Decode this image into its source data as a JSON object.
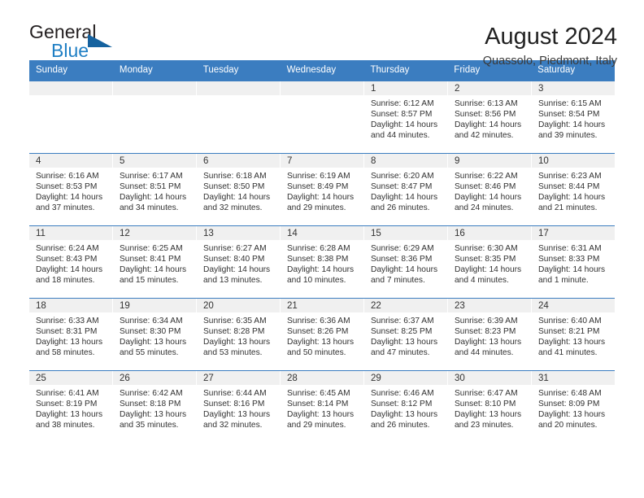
{
  "brand": {
    "name_part1": "General",
    "name_part2": "Blue",
    "triangle_icon": "triangle-icon",
    "accent_color": "#1f7fc4",
    "header_color": "#3b7dc0"
  },
  "header": {
    "title": "August 2024",
    "subtitle": "Quassolo, Piedmont, Italy"
  },
  "calendar": {
    "weekday_headers": [
      "Sunday",
      "Monday",
      "Tuesday",
      "Wednesday",
      "Thursday",
      "Friday",
      "Saturday"
    ],
    "labels": {
      "sunrise": "Sunrise:",
      "sunset": "Sunset:",
      "daylight": "Daylight:"
    },
    "weeks": [
      [
        {
          "day": "",
          "empty": true
        },
        {
          "day": "",
          "empty": true
        },
        {
          "day": "",
          "empty": true
        },
        {
          "day": "",
          "empty": true
        },
        {
          "day": "1",
          "sunrise": "Sunrise: 6:12 AM",
          "sunset": "Sunset: 8:57 PM",
          "daylight_l1": "Daylight: 14 hours",
          "daylight_l2": "and 44 minutes."
        },
        {
          "day": "2",
          "sunrise": "Sunrise: 6:13 AM",
          "sunset": "Sunset: 8:56 PM",
          "daylight_l1": "Daylight: 14 hours",
          "daylight_l2": "and 42 minutes."
        },
        {
          "day": "3",
          "sunrise": "Sunrise: 6:15 AM",
          "sunset": "Sunset: 8:54 PM",
          "daylight_l1": "Daylight: 14 hours",
          "daylight_l2": "and 39 minutes."
        }
      ],
      [
        {
          "day": "4",
          "sunrise": "Sunrise: 6:16 AM",
          "sunset": "Sunset: 8:53 PM",
          "daylight_l1": "Daylight: 14 hours",
          "daylight_l2": "and 37 minutes."
        },
        {
          "day": "5",
          "sunrise": "Sunrise: 6:17 AM",
          "sunset": "Sunset: 8:51 PM",
          "daylight_l1": "Daylight: 14 hours",
          "daylight_l2": "and 34 minutes."
        },
        {
          "day": "6",
          "sunrise": "Sunrise: 6:18 AM",
          "sunset": "Sunset: 8:50 PM",
          "daylight_l1": "Daylight: 14 hours",
          "daylight_l2": "and 32 minutes."
        },
        {
          "day": "7",
          "sunrise": "Sunrise: 6:19 AM",
          "sunset": "Sunset: 8:49 PM",
          "daylight_l1": "Daylight: 14 hours",
          "daylight_l2": "and 29 minutes."
        },
        {
          "day": "8",
          "sunrise": "Sunrise: 6:20 AM",
          "sunset": "Sunset: 8:47 PM",
          "daylight_l1": "Daylight: 14 hours",
          "daylight_l2": "and 26 minutes."
        },
        {
          "day": "9",
          "sunrise": "Sunrise: 6:22 AM",
          "sunset": "Sunset: 8:46 PM",
          "daylight_l1": "Daylight: 14 hours",
          "daylight_l2": "and 24 minutes."
        },
        {
          "day": "10",
          "sunrise": "Sunrise: 6:23 AM",
          "sunset": "Sunset: 8:44 PM",
          "daylight_l1": "Daylight: 14 hours",
          "daylight_l2": "and 21 minutes."
        }
      ],
      [
        {
          "day": "11",
          "sunrise": "Sunrise: 6:24 AM",
          "sunset": "Sunset: 8:43 PM",
          "daylight_l1": "Daylight: 14 hours",
          "daylight_l2": "and 18 minutes."
        },
        {
          "day": "12",
          "sunrise": "Sunrise: 6:25 AM",
          "sunset": "Sunset: 8:41 PM",
          "daylight_l1": "Daylight: 14 hours",
          "daylight_l2": "and 15 minutes."
        },
        {
          "day": "13",
          "sunrise": "Sunrise: 6:27 AM",
          "sunset": "Sunset: 8:40 PM",
          "daylight_l1": "Daylight: 14 hours",
          "daylight_l2": "and 13 minutes."
        },
        {
          "day": "14",
          "sunrise": "Sunrise: 6:28 AM",
          "sunset": "Sunset: 8:38 PM",
          "daylight_l1": "Daylight: 14 hours",
          "daylight_l2": "and 10 minutes."
        },
        {
          "day": "15",
          "sunrise": "Sunrise: 6:29 AM",
          "sunset": "Sunset: 8:36 PM",
          "daylight_l1": "Daylight: 14 hours",
          "daylight_l2": "and 7 minutes."
        },
        {
          "day": "16",
          "sunrise": "Sunrise: 6:30 AM",
          "sunset": "Sunset: 8:35 PM",
          "daylight_l1": "Daylight: 14 hours",
          "daylight_l2": "and 4 minutes."
        },
        {
          "day": "17",
          "sunrise": "Sunrise: 6:31 AM",
          "sunset": "Sunset: 8:33 PM",
          "daylight_l1": "Daylight: 14 hours",
          "daylight_l2": "and 1 minute."
        }
      ],
      [
        {
          "day": "18",
          "sunrise": "Sunrise: 6:33 AM",
          "sunset": "Sunset: 8:31 PM",
          "daylight_l1": "Daylight: 13 hours",
          "daylight_l2": "and 58 minutes."
        },
        {
          "day": "19",
          "sunrise": "Sunrise: 6:34 AM",
          "sunset": "Sunset: 8:30 PM",
          "daylight_l1": "Daylight: 13 hours",
          "daylight_l2": "and 55 minutes."
        },
        {
          "day": "20",
          "sunrise": "Sunrise: 6:35 AM",
          "sunset": "Sunset: 8:28 PM",
          "daylight_l1": "Daylight: 13 hours",
          "daylight_l2": "and 53 minutes."
        },
        {
          "day": "21",
          "sunrise": "Sunrise: 6:36 AM",
          "sunset": "Sunset: 8:26 PM",
          "daylight_l1": "Daylight: 13 hours",
          "daylight_l2": "and 50 minutes."
        },
        {
          "day": "22",
          "sunrise": "Sunrise: 6:37 AM",
          "sunset": "Sunset: 8:25 PM",
          "daylight_l1": "Daylight: 13 hours",
          "daylight_l2": "and 47 minutes."
        },
        {
          "day": "23",
          "sunrise": "Sunrise: 6:39 AM",
          "sunset": "Sunset: 8:23 PM",
          "daylight_l1": "Daylight: 13 hours",
          "daylight_l2": "and 44 minutes."
        },
        {
          "day": "24",
          "sunrise": "Sunrise: 6:40 AM",
          "sunset": "Sunset: 8:21 PM",
          "daylight_l1": "Daylight: 13 hours",
          "daylight_l2": "and 41 minutes."
        }
      ],
      [
        {
          "day": "25",
          "sunrise": "Sunrise: 6:41 AM",
          "sunset": "Sunset: 8:19 PM",
          "daylight_l1": "Daylight: 13 hours",
          "daylight_l2": "and 38 minutes."
        },
        {
          "day": "26",
          "sunrise": "Sunrise: 6:42 AM",
          "sunset": "Sunset: 8:18 PM",
          "daylight_l1": "Daylight: 13 hours",
          "daylight_l2": "and 35 minutes."
        },
        {
          "day": "27",
          "sunrise": "Sunrise: 6:44 AM",
          "sunset": "Sunset: 8:16 PM",
          "daylight_l1": "Daylight: 13 hours",
          "daylight_l2": "and 32 minutes."
        },
        {
          "day": "28",
          "sunrise": "Sunrise: 6:45 AM",
          "sunset": "Sunset: 8:14 PM",
          "daylight_l1": "Daylight: 13 hours",
          "daylight_l2": "and 29 minutes."
        },
        {
          "day": "29",
          "sunrise": "Sunrise: 6:46 AM",
          "sunset": "Sunset: 8:12 PM",
          "daylight_l1": "Daylight: 13 hours",
          "daylight_l2": "and 26 minutes."
        },
        {
          "day": "30",
          "sunrise": "Sunrise: 6:47 AM",
          "sunset": "Sunset: 8:10 PM",
          "daylight_l1": "Daylight: 13 hours",
          "daylight_l2": "and 23 minutes."
        },
        {
          "day": "31",
          "sunrise": "Sunrise: 6:48 AM",
          "sunset": "Sunset: 8:09 PM",
          "daylight_l1": "Daylight: 13 hours",
          "daylight_l2": "and 20 minutes."
        }
      ]
    ]
  }
}
